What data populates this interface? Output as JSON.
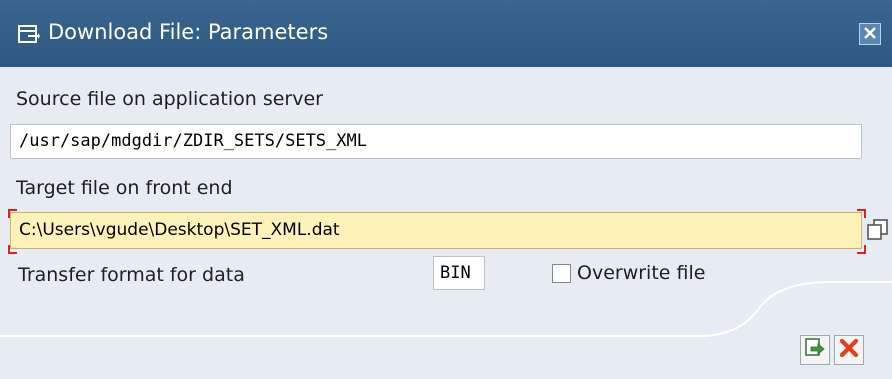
{
  "dialog": {
    "title": "Download File: Parameters"
  },
  "form": {
    "source_label": "Source file on application server",
    "source_value": "/usr/sap/mdgdir/ZDIR_SETS/SETS_XML",
    "target_label": "Target file on front end",
    "target_value": "C:\\Users\\vgude\\Desktop\\SET_XML.dat",
    "format_label": "Transfer format for data",
    "format_value": "BIN",
    "overwrite_label": "Overwrite file",
    "overwrite_checked": false
  },
  "icons": {
    "title": "dialog-window-icon",
    "close": "close-icon",
    "value_help": "copy-value-help-icon",
    "continue": "continue-check-icon",
    "cancel": "cancel-x-icon"
  },
  "colors": {
    "titlebar": "#2f5c86",
    "body_background": "#e6ecf2",
    "active_field": "#fff2b8",
    "required_marker": "#e02020",
    "cancel": "#e0401a",
    "continue": "#3a9a3a"
  }
}
